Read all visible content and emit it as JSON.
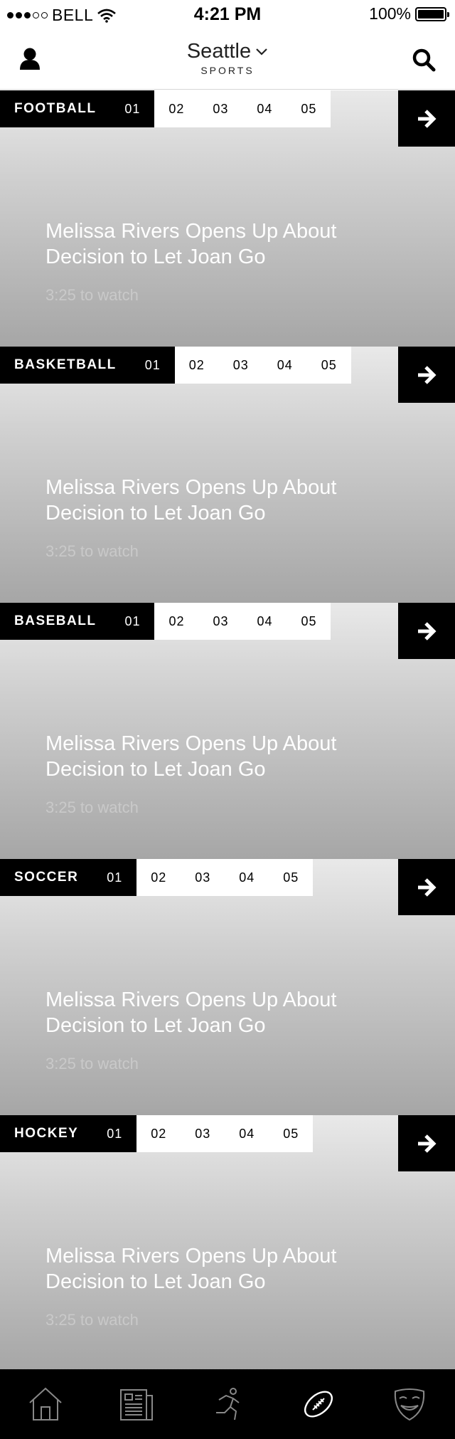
{
  "status_bar": {
    "carrier": "BELL",
    "time": "4:21 PM",
    "battery": "100%",
    "signal_filled": 3,
    "signal_total": 5
  },
  "header": {
    "city": "Seattle",
    "section": "SPORTS"
  },
  "sections": [
    {
      "sport": "FOOTBALL",
      "pages": [
        "01",
        "02",
        "03",
        "04",
        "05"
      ],
      "active_page": "01",
      "headline": "Melissa Rivers Opens Up About Decision to Let Joan Go",
      "duration": "3:25 to watch"
    },
    {
      "sport": "BASKETBALL",
      "pages": [
        "01",
        "02",
        "03",
        "04",
        "05"
      ],
      "active_page": "01",
      "headline": "Melissa Rivers Opens Up About Decision to Let Joan Go",
      "duration": "3:25 to watch"
    },
    {
      "sport": "BASEBALL",
      "pages": [
        "01",
        "02",
        "03",
        "04",
        "05"
      ],
      "active_page": "01",
      "headline": "Melissa Rivers Opens Up About Decision to Let Joan Go",
      "duration": "3:25 to watch"
    },
    {
      "sport": "SOCCER",
      "pages": [
        "01",
        "02",
        "03",
        "04",
        "05"
      ],
      "active_page": "01",
      "headline": "Melissa Rivers Opens Up About Decision to Let Joan Go",
      "duration": "3:25 to watch"
    },
    {
      "sport": "HOCKEY",
      "pages": [
        "01",
        "02",
        "03",
        "04",
        "05"
      ],
      "active_page": "01",
      "headline": "Melissa Rivers Opens Up About Decision to Let Joan Go",
      "duration": "3:25 to watch"
    }
  ],
  "bottom_nav": {
    "items": [
      "home-icon",
      "news-icon",
      "running-icon",
      "football-icon",
      "mask-icon"
    ],
    "active": "football-icon"
  },
  "colors": {
    "accent": "#000000",
    "gradient_top": "#e9e9e9",
    "gradient_bottom": "#a6a6a6",
    "duration_text": "#c9c9c9"
  }
}
